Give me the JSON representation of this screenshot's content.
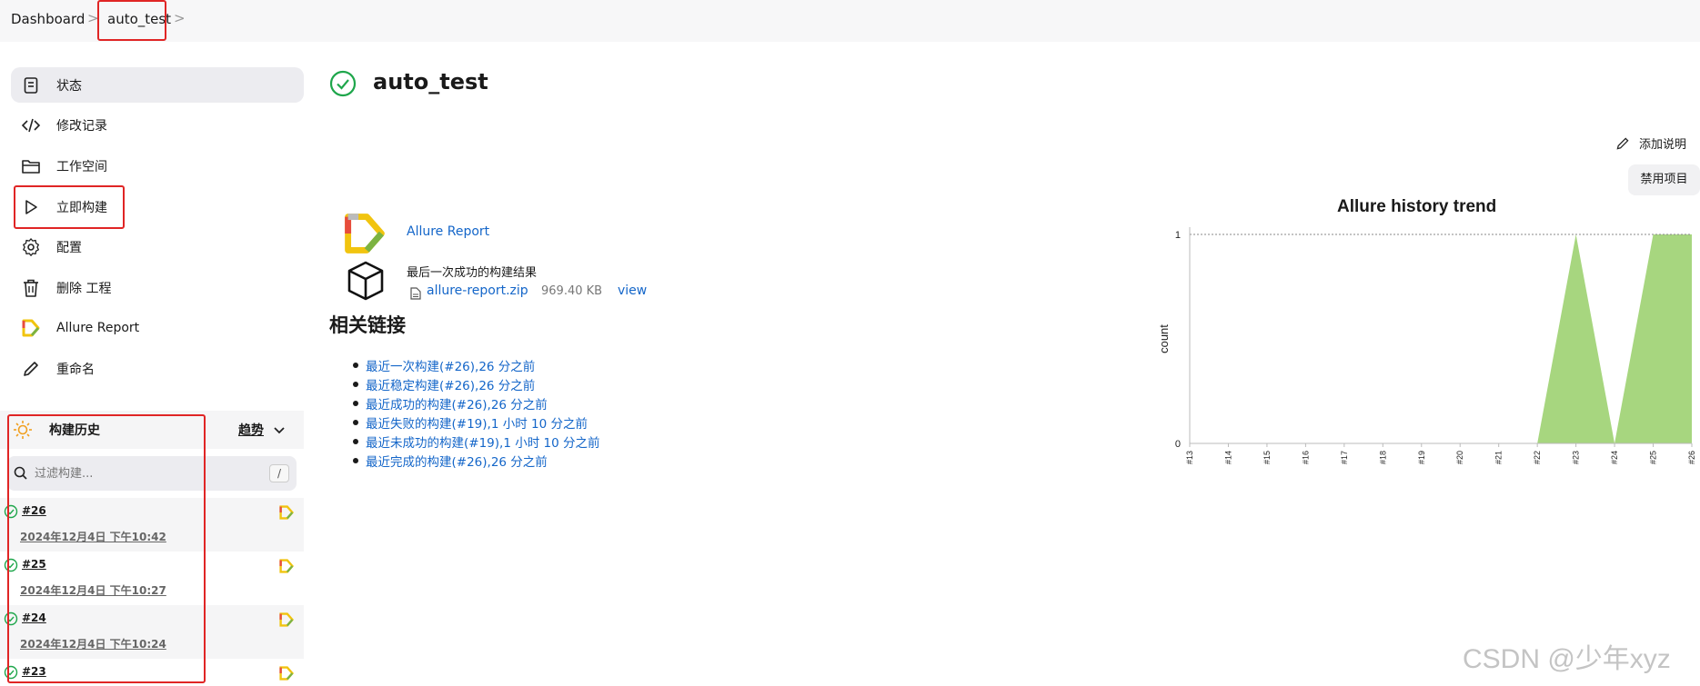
{
  "breadcrumb": {
    "root": "Dashboard",
    "current": "auto_test",
    "sep": ">"
  },
  "sidebar": {
    "items": [
      {
        "label": "状态",
        "icon": "document-icon"
      },
      {
        "label": "修改记录",
        "icon": "code-icon"
      },
      {
        "label": "工作空间",
        "icon": "folder-icon"
      },
      {
        "label": "立即构建",
        "icon": "play-icon"
      },
      {
        "label": "配置",
        "icon": "gear-icon"
      },
      {
        "label": "删除 工程",
        "icon": "trash-icon"
      },
      {
        "label": "Allure Report",
        "icon": "allure-logo-icon"
      },
      {
        "label": "重命名",
        "icon": "pencil-icon"
      }
    ]
  },
  "history": {
    "title": "构建历史",
    "trend": "趋势",
    "filter_placeholder": "过滤构建...",
    "filter_shortcut": "/",
    "builds": [
      {
        "num": "#26",
        "date": "2024年12月4日 下午10:42"
      },
      {
        "num": "#25",
        "date": "2024年12月4日 下午10:27"
      },
      {
        "num": "#24",
        "date": "2024年12月4日 下午10:24"
      },
      {
        "num": "#23",
        "date": ""
      }
    ]
  },
  "main": {
    "title": "auto_test",
    "add_desc": "添加说明",
    "disable": "禁用项目",
    "allure_link": "Allure Report",
    "artifact_title": "最后一次成功的构建结果",
    "artifact_file": "allure-report.zip",
    "artifact_size": "969.40 KB",
    "artifact_view": "view",
    "related_title": "相关链接",
    "related_links": [
      "最近一次构建(#26),26 分之前",
      "最近稳定构建(#26),26 分之前",
      "最近成功的构建(#26),26 分之前",
      "最近失败的构建(#19),1 小时 10 分之前",
      "最近未成功的构建(#19),1 小时 10 分之前",
      "最近完成的构建(#26),26 分之前"
    ]
  },
  "chart_data": {
    "type": "area",
    "title": "Allure history trend",
    "ylabel": "count",
    "xlabel": "",
    "categories": [
      "#13",
      "#14",
      "#15",
      "#16",
      "#17",
      "#18",
      "#19",
      "#20",
      "#21",
      "#22",
      "#23",
      "#24",
      "#25",
      "#26"
    ],
    "series": [
      {
        "values": [
          0,
          0,
          0,
          0,
          0,
          0,
          0,
          0,
          0,
          0,
          1,
          0,
          1,
          1
        ]
      }
    ],
    "ylim": [
      0,
      1
    ],
    "yticks": [
      "0",
      "1"
    ],
    "color": "#a7d67f",
    "grid": false
  },
  "watermark": "CSDN @少年xyz",
  "colors": {
    "success": "#1ea64b",
    "link": "#1466c9",
    "highlight": "#e02525"
  }
}
